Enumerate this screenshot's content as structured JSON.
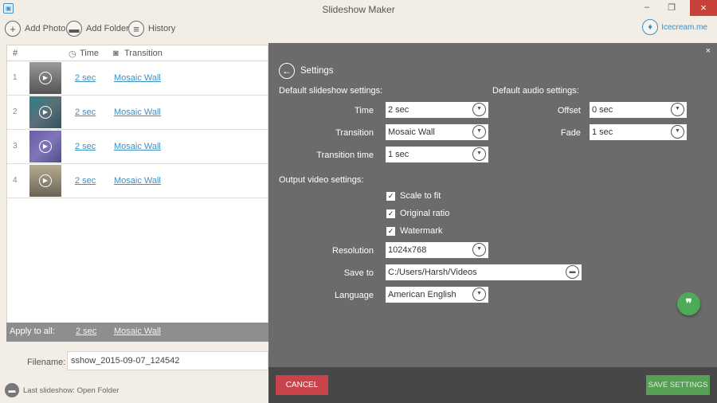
{
  "window": {
    "title": "Slideshow Maker"
  },
  "toolbar": {
    "add_photo": "Add Photo",
    "add_folder": "Add Folder",
    "history": "History",
    "brand": "Icecream.me"
  },
  "list": {
    "headers": {
      "num": "#",
      "time": "Time",
      "transition": "Transition"
    },
    "rows": [
      {
        "num": "1",
        "time": "2 sec",
        "transition": "Mosaic Wall"
      },
      {
        "num": "2",
        "time": "2 sec",
        "transition": "Mosaic Wall"
      },
      {
        "num": "3",
        "time": "2 sec",
        "transition": "Mosaic Wall"
      },
      {
        "num": "4",
        "time": "2 sec",
        "transition": "Mosaic Wall"
      }
    ],
    "apply_all": {
      "label": "Apply to all:",
      "time": "2 sec",
      "transition": "Mosaic Wall"
    }
  },
  "filename": {
    "label": "Filename:",
    "value": "sshow_2015-09-07_124542"
  },
  "last_slideshow": "Last slideshow: Open Folder",
  "settings": {
    "title": "Settings",
    "close": "×",
    "default_slideshow": "Default slideshow settings:",
    "default_audio": "Default audio settings:",
    "output_video": "Output video settings:",
    "time_label": "Time",
    "time_value": "2 sec",
    "transition_label": "Transition",
    "transition_value": "Mosaic Wall",
    "transition_time_label": "Transition time",
    "transition_time_value": "1 sec",
    "offset_label": "Offset",
    "offset_value": "0 sec",
    "fade_label": "Fade",
    "fade_value": "1 sec",
    "scale_to_fit": "Scale to fit",
    "original_ratio": "Original ratio",
    "watermark": "Watermark",
    "resolution_label": "Resolution",
    "resolution_value": "1024x768",
    "save_to_label": "Save to",
    "save_to_value": "C:/Users/Harsh/Videos",
    "language_label": "Language",
    "language_value": "American English"
  },
  "footer": {
    "cancel": "CANCEL",
    "save": "SAVE SETTINGS"
  },
  "colors": {
    "accent": "#3d8fc5",
    "cancel": "#c8434a",
    "save": "#55a055",
    "panel": "#6b6b6b"
  }
}
